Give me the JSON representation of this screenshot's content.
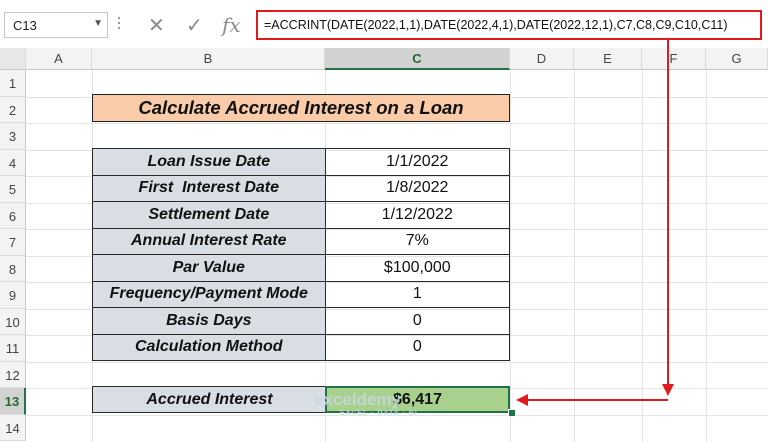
{
  "formula_bar": {
    "name_box": "C13",
    "formula": "=ACCRINT(DATE(2022,1,1),DATE(2022,4,1),DATE(2022,12,1),C7,C8,C9,C10,C11)",
    "icons": [
      "cancel-icon",
      "enter-icon",
      "function-icon"
    ]
  },
  "columns": [
    "A",
    "B",
    "C",
    "D",
    "E",
    "F",
    "G"
  ],
  "rows": [
    "1",
    "2",
    "3",
    "4",
    "5",
    "6",
    "7",
    "8",
    "9",
    "10",
    "11",
    "12",
    "13",
    "14"
  ],
  "title": "Calculate Accrued Interest on a Loan",
  "table": [
    {
      "label": "Loan Issue Date",
      "value": "1/1/2022"
    },
    {
      "label": "First  Interest Date",
      "value": "1/8/2022"
    },
    {
      "label": "Settlement Date",
      "value": "1/12/2022"
    },
    {
      "label": "Annual Interest Rate",
      "value": "7%"
    },
    {
      "label": "Par Value",
      "value": "$100,000"
    },
    {
      "label": "Frequency/Payment Mode",
      "value": "1"
    },
    {
      "label": "Basis Days",
      "value": "0"
    },
    {
      "label": "Calculation Method",
      "value": "0"
    }
  ],
  "result": {
    "label": "Accrued Interest",
    "value": "$6,417"
  },
  "watermark": {
    "name": "exceldemy",
    "tagline": "EXCEL · DATA · BI"
  },
  "colors": {
    "highlight": "#e01b1b",
    "title_fill": "#f9cba8",
    "label_fill": "#d9dde4",
    "result_fill": "#a9d18e",
    "selection": "#217346"
  }
}
